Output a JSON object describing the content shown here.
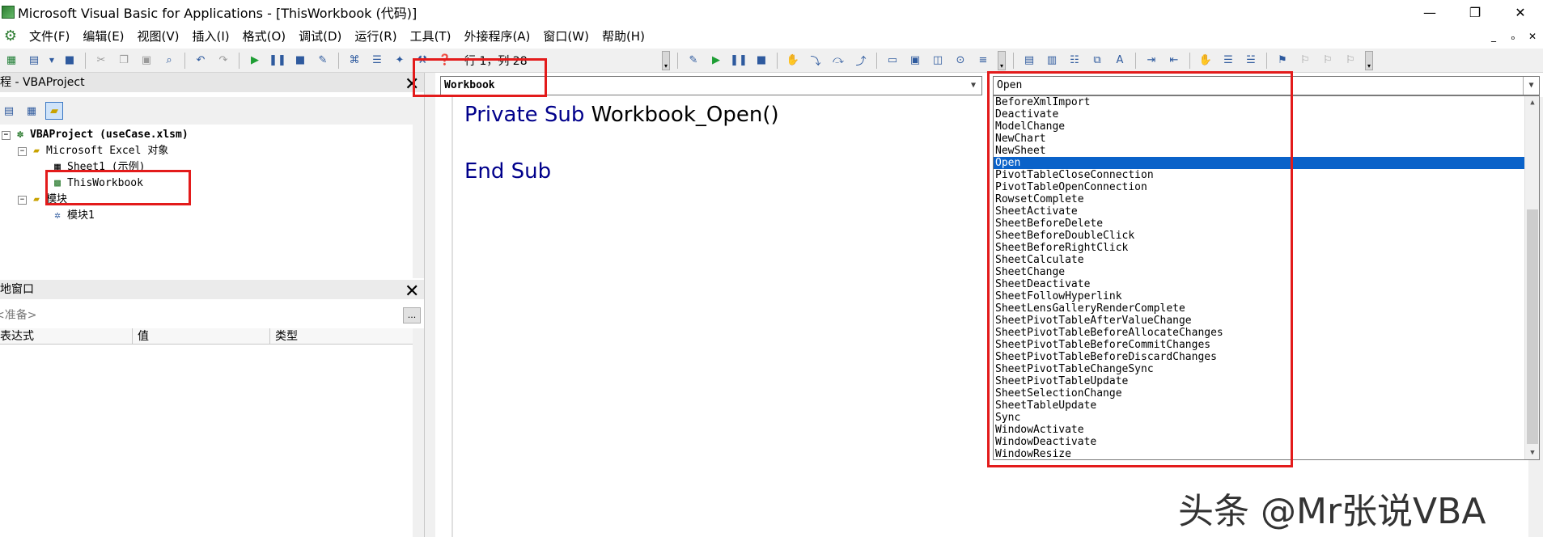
{
  "window": {
    "title": "Microsoft Visual Basic for Applications - [ThisWorkbook (代码)]",
    "minimize": "—",
    "restore": "❐",
    "close": "✕"
  },
  "menu": {
    "items": [
      "文件(F)",
      "编辑(E)",
      "视图(V)",
      "插入(I)",
      "格式(O)",
      "调试(D)",
      "运行(R)",
      "工具(T)",
      "外接程序(A)",
      "窗口(W)",
      "帮助(H)"
    ],
    "mdi_minimize": "_",
    "mdi_restore": "ₒ",
    "mdi_close": "✕"
  },
  "toolbar": {
    "cursor_position": "行 1，列 28"
  },
  "project": {
    "header": "工程 - VBAProject",
    "tree": {
      "root": "VBAProject (useCase.xlsm)",
      "excel_objects": "Microsoft Excel 对象",
      "sheet1": "Sheet1 (示例)",
      "thisworkbook": "ThisWorkbook",
      "modules": "模块",
      "module1": "模块1"
    }
  },
  "locals": {
    "header": "本地窗口",
    "status": "<准备>",
    "more": "...",
    "columns": [
      "表达式",
      "值",
      "类型"
    ]
  },
  "code": {
    "object_combo": "Workbook",
    "procedure_combo": "Open",
    "line1_keyword": "Private Sub",
    "line1_rest": " Workbook_Open()",
    "line2": "End Sub"
  },
  "dropdown": {
    "selected": "Open",
    "items": [
      "BeforeXmlImport",
      "Deactivate",
      "ModelChange",
      "NewChart",
      "NewSheet",
      "Open",
      "PivotTableCloseConnection",
      "PivotTableOpenConnection",
      "RowsetComplete",
      "SheetActivate",
      "SheetBeforeDelete",
      "SheetBeforeDoubleClick",
      "SheetBeforeRightClick",
      "SheetCalculate",
      "SheetChange",
      "SheetDeactivate",
      "SheetFollowHyperlink",
      "SheetLensGalleryRenderComplete",
      "SheetPivotTableAfterValueChange",
      "SheetPivotTableBeforeAllocateChanges",
      "SheetPivotTableBeforeCommitChanges",
      "SheetPivotTableBeforeDiscardChanges",
      "SheetPivotTableChangeSync",
      "SheetPivotTableUpdate",
      "SheetSelectionChange",
      "SheetTableUpdate",
      "Sync",
      "WindowActivate",
      "WindowDeactivate",
      "WindowResize"
    ]
  },
  "watermark": "头条 @Mr张说VBA",
  "colors": {
    "accent_red": "#e31b1b",
    "selection_blue": "#0a62c9",
    "keyword_blue": "#00008b"
  }
}
